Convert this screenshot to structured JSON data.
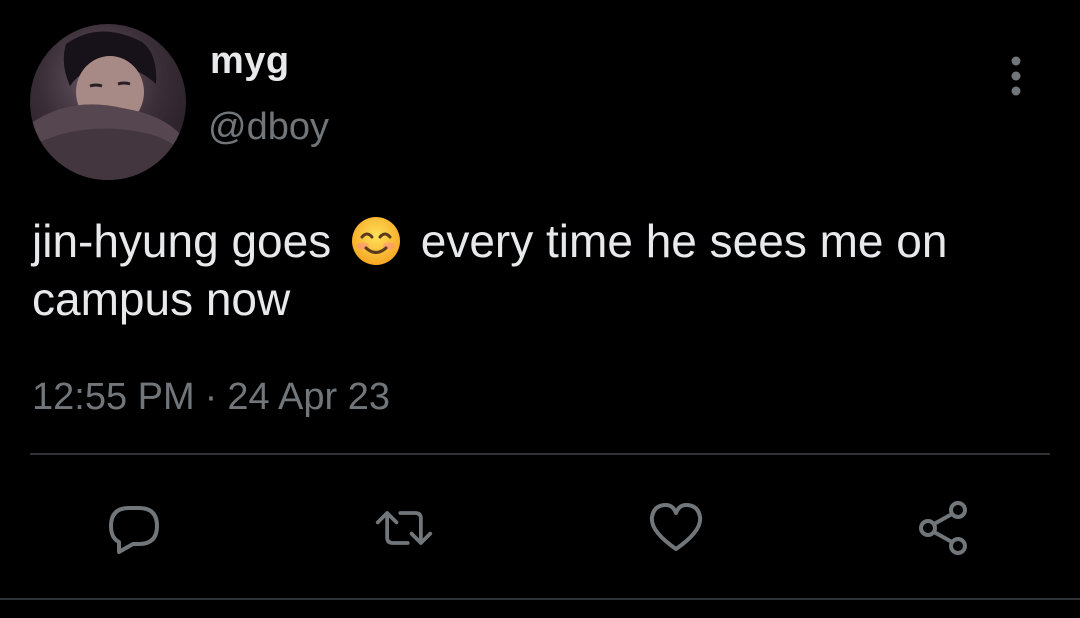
{
  "user": {
    "display_name": "myg",
    "handle": "@dboy",
    "avatar_icon": "profile-photo"
  },
  "tweet": {
    "text_before_emoji": "jin-hyung goes",
    "emoji": "smiling-face-with-smiling-eyes",
    "text_after_emoji": "every time he sees me on campus now",
    "time": "12:55 PM",
    "separator": "·",
    "date": "24 Apr 23"
  },
  "actions": [
    {
      "name": "reply",
      "icon": "comment-icon"
    },
    {
      "name": "retweet",
      "icon": "retweet-icon"
    },
    {
      "name": "like",
      "icon": "heart-icon"
    },
    {
      "name": "share",
      "icon": "share-icon"
    }
  ],
  "colors": {
    "background": "#000000",
    "primary_text": "#e7e9ea",
    "secondary_text": "#71767b",
    "divider": "#2f3336"
  }
}
